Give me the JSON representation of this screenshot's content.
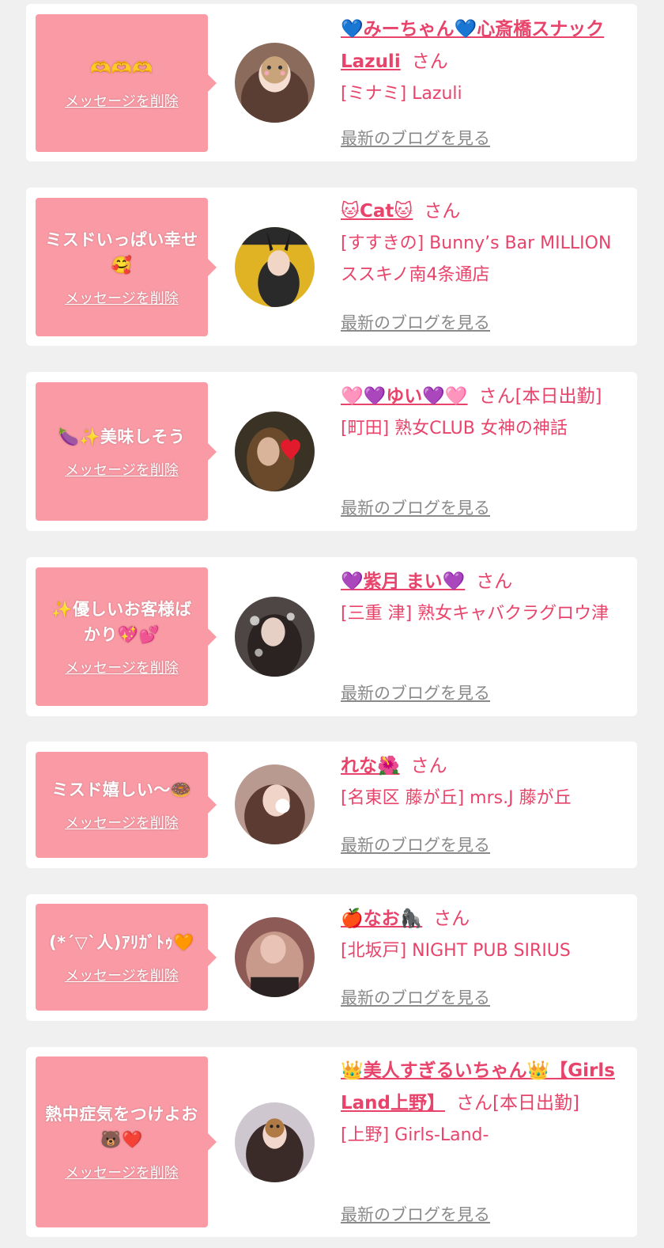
{
  "cards": [
    {
      "message": "🫶🫶🫶",
      "delete_label": "メッセージを削除",
      "name": "💙みーちゃん💙心斎橋スナックLazuli",
      "honorific": "さん",
      "shop": "[ミナミ] Lazuli",
      "blog_label": "最新のブログを見る"
    },
    {
      "message": "ミスドいっぱい幸せ🥰",
      "delete_label": "メッセージを削除",
      "name": "🐱Cat🐱",
      "honorific": "さん",
      "shop": "[すすきの] Bunny’s Bar MILLION ススキノ南4条通店",
      "blog_label": "最新のブログを見る"
    },
    {
      "message": "🍆✨美味しそう",
      "delete_label": "メッセージを削除",
      "name": "🩷💜ゆい💜🩷",
      "honorific": "さん[本日出勤]",
      "shop": "[町田] 熟女CLUB 女神の神話",
      "blog_label": "最新のブログを見る"
    },
    {
      "message": "✨優しいお客様ばかり💖💕",
      "delete_label": "メッセージを削除",
      "name": "💜紫月 まい💜",
      "honorific": "さん",
      "shop": "[三重 津] 熟女キャバクラグロウ津",
      "blog_label": "最新のブログを見る"
    },
    {
      "message": "ミスド嬉しい〜🍩",
      "delete_label": "メッセージを削除",
      "name": "れな🌺",
      "honorific": "さん",
      "shop": "[名東区 藤が丘] mrs.J 藤が丘",
      "blog_label": "最新のブログを見る"
    },
    {
      "message": "(*´▽`人)ｱﾘｶﾞﾄｩ🧡",
      "delete_label": "メッセージを削除",
      "name": "🍎なお🦍",
      "honorific": "さん",
      "shop": "[北坂戸] NIGHT PUB SIRIUS",
      "blog_label": "最新のブログを見る"
    },
    {
      "message": "熱中症気をつけよお🐻❤️",
      "delete_label": "メッセージを削除",
      "name": "👑美人すぎるいちゃん👑【Girls Land上野】",
      "honorific": "さん[本日出勤]",
      "shop": "[上野] Girls-Land-",
      "blog_label": "最新のブログを見る"
    }
  ],
  "colors": {
    "background": "#f0f0f0",
    "card": "#ffffff",
    "bubble": "#f99aa5",
    "accent_pink": "#e8436a",
    "blog_link": "#8a8a8a"
  }
}
